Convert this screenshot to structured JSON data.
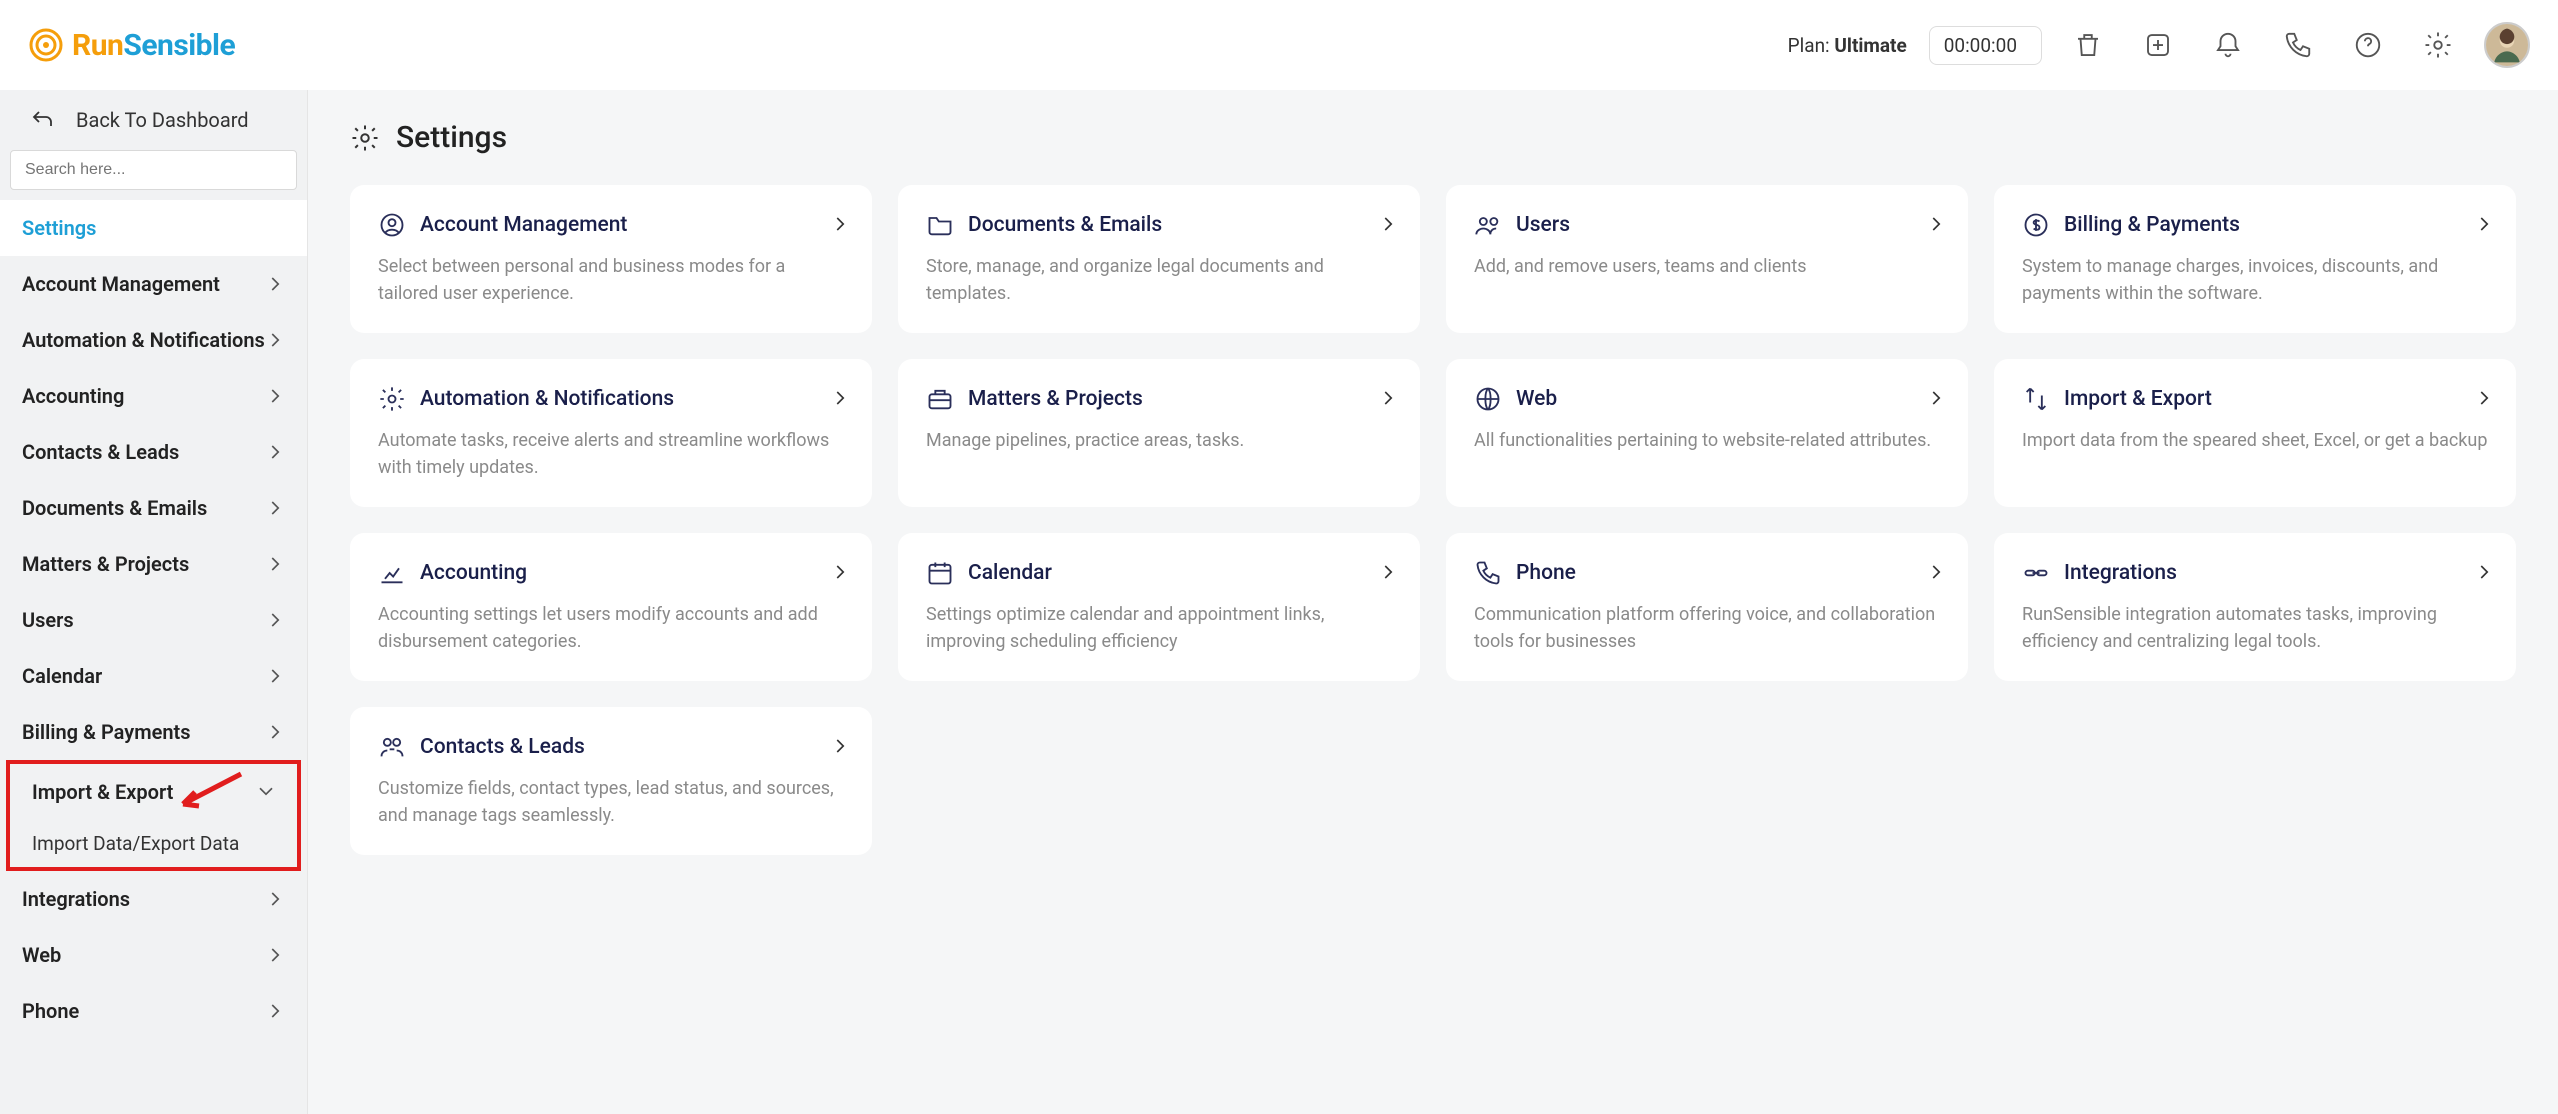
{
  "header": {
    "logo_run": "Run",
    "logo_sensible": "Sensible",
    "plan_label": "Plan:",
    "plan_value": "Ultimate",
    "timer": "00:00:00"
  },
  "sidebar": {
    "back_label": "Back To Dashboard",
    "search_placeholder": "Search here...",
    "active_label": "Settings",
    "items": [
      {
        "label": "Account Management"
      },
      {
        "label": "Automation & Notifications"
      },
      {
        "label": "Accounting"
      },
      {
        "label": "Contacts & Leads"
      },
      {
        "label": "Documents & Emails"
      },
      {
        "label": "Matters & Projects"
      },
      {
        "label": "Users"
      },
      {
        "label": "Calendar"
      },
      {
        "label": "Billing & Payments"
      }
    ],
    "highlighted": {
      "parent": "Import & Export",
      "child": "Import Data/Export Data"
    },
    "after": [
      {
        "label": "Integrations"
      },
      {
        "label": "Web"
      },
      {
        "label": "Phone"
      }
    ]
  },
  "page": {
    "title": "Settings"
  },
  "cards": [
    {
      "title": "Account Management",
      "desc": "Select between personal and business modes for a tailored user experience.",
      "icon": "user-circle"
    },
    {
      "title": "Documents & Emails",
      "desc": "Store, manage, and organize legal documents and templates.",
      "icon": "folder"
    },
    {
      "title": "Users",
      "desc": "Add, and remove users, teams and clients",
      "icon": "users"
    },
    {
      "title": "Billing & Payments",
      "desc": "System to manage charges, invoices, discounts, and payments within the software.",
      "icon": "dollar"
    },
    {
      "title": "Automation & Notifications",
      "desc": "Automate tasks, receive alerts and streamline workflows with timely updates.",
      "icon": "gear"
    },
    {
      "title": "Matters & Projects",
      "desc": "Manage pipelines, practice areas, tasks.",
      "icon": "briefcase"
    },
    {
      "title": "Web",
      "desc": "All functionalities pertaining to website-related attributes.",
      "icon": "globe"
    },
    {
      "title": "Import & Export",
      "desc": "Import data from the speared sheet, Excel, or get a backup",
      "icon": "arrows"
    },
    {
      "title": "Accounting",
      "desc": "Accounting settings let users modify accounts and add disbursement categories.",
      "icon": "chart"
    },
    {
      "title": "Calendar",
      "desc": "Settings optimize calendar and appointment links, improving scheduling efficiency",
      "icon": "calendar"
    },
    {
      "title": "Phone",
      "desc": "Communication platform offering voice, and collaboration tools for businesses",
      "icon": "phone"
    },
    {
      "title": "Integrations",
      "desc": "RunSensible integration automates tasks, improving efficiency and centralizing legal tools.",
      "icon": "link"
    },
    {
      "title": "Contacts & Leads",
      "desc": "Customize fields, contact types, lead status, and sources, and manage tags seamlessly.",
      "icon": "contacts"
    }
  ]
}
